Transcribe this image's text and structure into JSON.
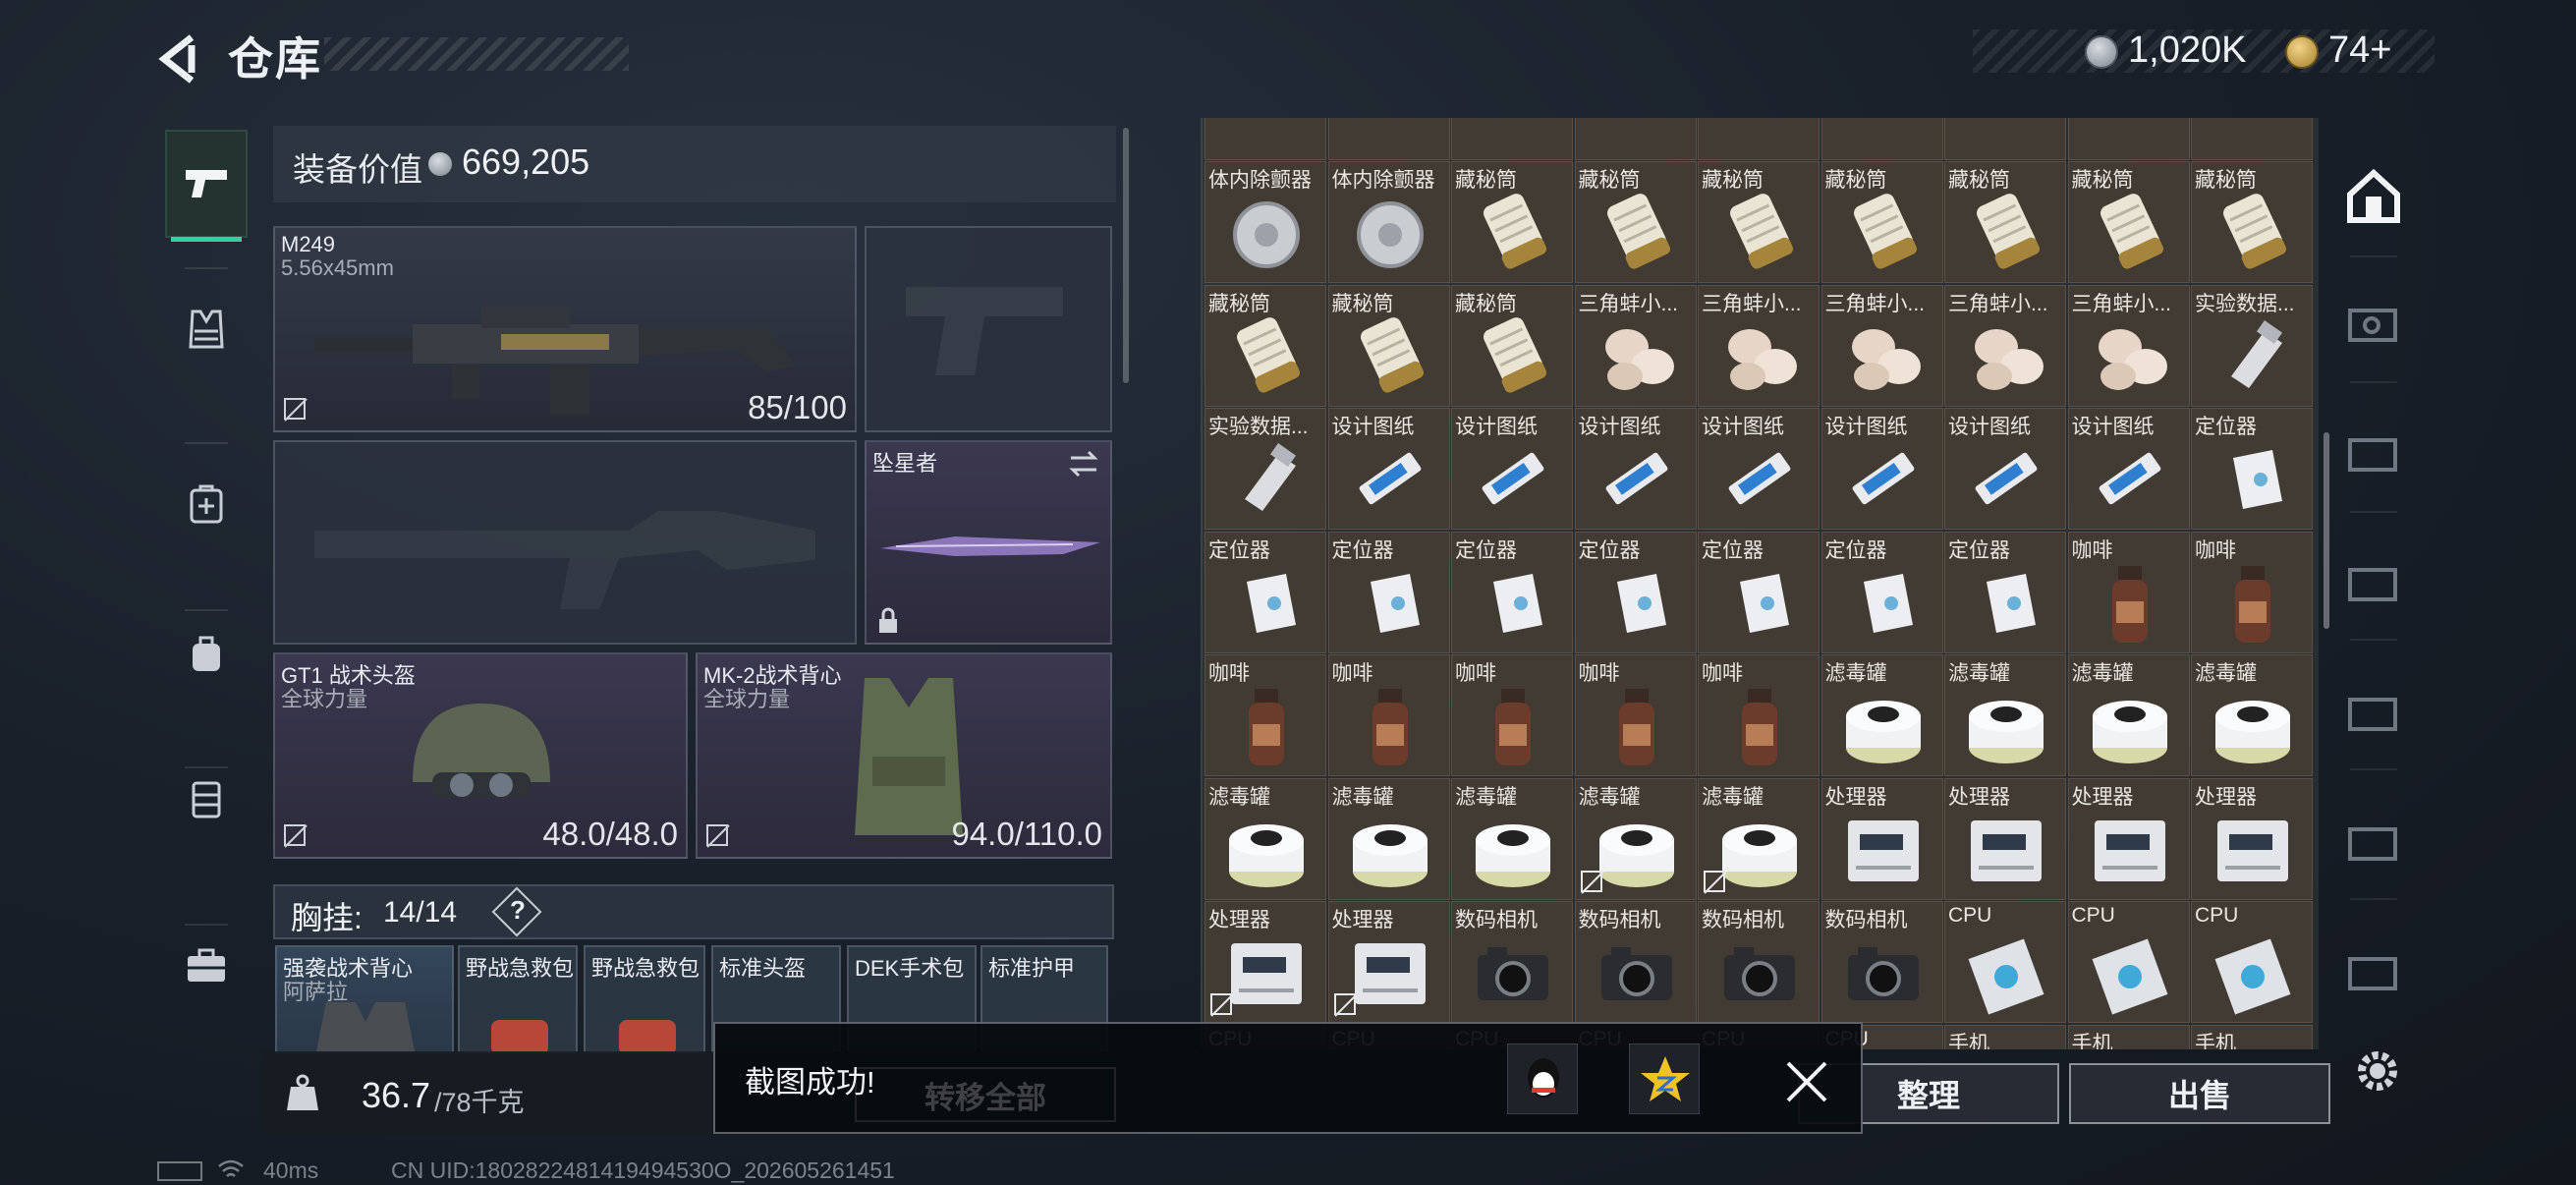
{
  "header": {
    "title": "仓库",
    "currency": "1,020K",
    "tickets": "74+"
  },
  "equipment": {
    "value_label": "装备价值",
    "value": "669,205",
    "primary_weapon": {
      "name": "M249",
      "ammo": "5.56x45mm",
      "durability": "85/100"
    },
    "melee": {
      "name": "坠星者"
    },
    "helmet": {
      "name": "GT1 战术头盔",
      "faction": "全球力量",
      "durability": "48.0/48.0"
    },
    "armor": {
      "name": "MK-2战术背心",
      "faction": "全球力量",
      "durability": "94.0/110.0"
    },
    "rig": {
      "label": "胸挂:",
      "count": "14/14",
      "help": "?"
    },
    "rig_items": [
      {
        "name": "强袭战术背心",
        "sub": "阿萨拉"
      },
      {
        "name": "野战急救包",
        "sub": ""
      },
      {
        "name": "野战急救包",
        "sub": ""
      },
      {
        "name": "标准头盔",
        "sub": ""
      },
      {
        "name": "DEK手术包",
        "sub": ""
      },
      {
        "name": "标准护甲",
        "sub": ""
      }
    ],
    "weight_value": "36.7",
    "weight_max": "/78千克"
  },
  "storage": {
    "rows": [
      [
        "体内除颤器",
        "体内除颤器",
        "藏秘筒",
        "藏秘筒",
        "藏秘筒",
        "藏秘筒",
        "藏秘筒",
        "藏秘筒",
        "藏秘筒"
      ],
      [
        "藏秘筒",
        "藏秘筒",
        "藏秘筒",
        "三角蚌小...",
        "三角蚌小...",
        "三角蚌小...",
        "三角蚌小...",
        "三角蚌小...",
        "实验数据..."
      ],
      [
        "实验数据...",
        "设计图纸",
        "设计图纸",
        "设计图纸",
        "设计图纸",
        "设计图纸",
        "设计图纸",
        "设计图纸",
        "定位器"
      ],
      [
        "定位器",
        "定位器",
        "定位器",
        "定位器",
        "定位器",
        "定位器",
        "定位器",
        "咖啡",
        "咖啡"
      ],
      [
        "咖啡",
        "咖啡",
        "咖啡",
        "咖啡",
        "咖啡",
        "滤毒罐",
        "滤毒罐",
        "滤毒罐",
        "滤毒罐"
      ],
      [
        "滤毒罐",
        "滤毒罐",
        "滤毒罐",
        "滤毒罐",
        "滤毒罐",
        "处理器",
        "处理器",
        "处理器",
        "处理器"
      ],
      [
        "处理器",
        "处理器",
        "数码相机",
        "数码相机",
        "数码相机",
        "数码相机",
        "CPU",
        "CPU",
        "CPU"
      ],
      [
        "CPU",
        "CPU",
        "CPU",
        "CPU",
        "CPU",
        "CPU",
        "手机",
        "手机",
        "手机"
      ]
    ]
  },
  "actions": {
    "transfer_all": "转移全部",
    "sort": "整理",
    "sell": "出售"
  },
  "toast": {
    "message": "截图成功!"
  },
  "status": {
    "ping": "40ms",
    "uid": "CN UID:1802822481419494530O_202605261451"
  },
  "colors": {
    "accent": "#2fd2a0",
    "cell_bg": "#423b33",
    "toast_bg": "#08090d"
  }
}
